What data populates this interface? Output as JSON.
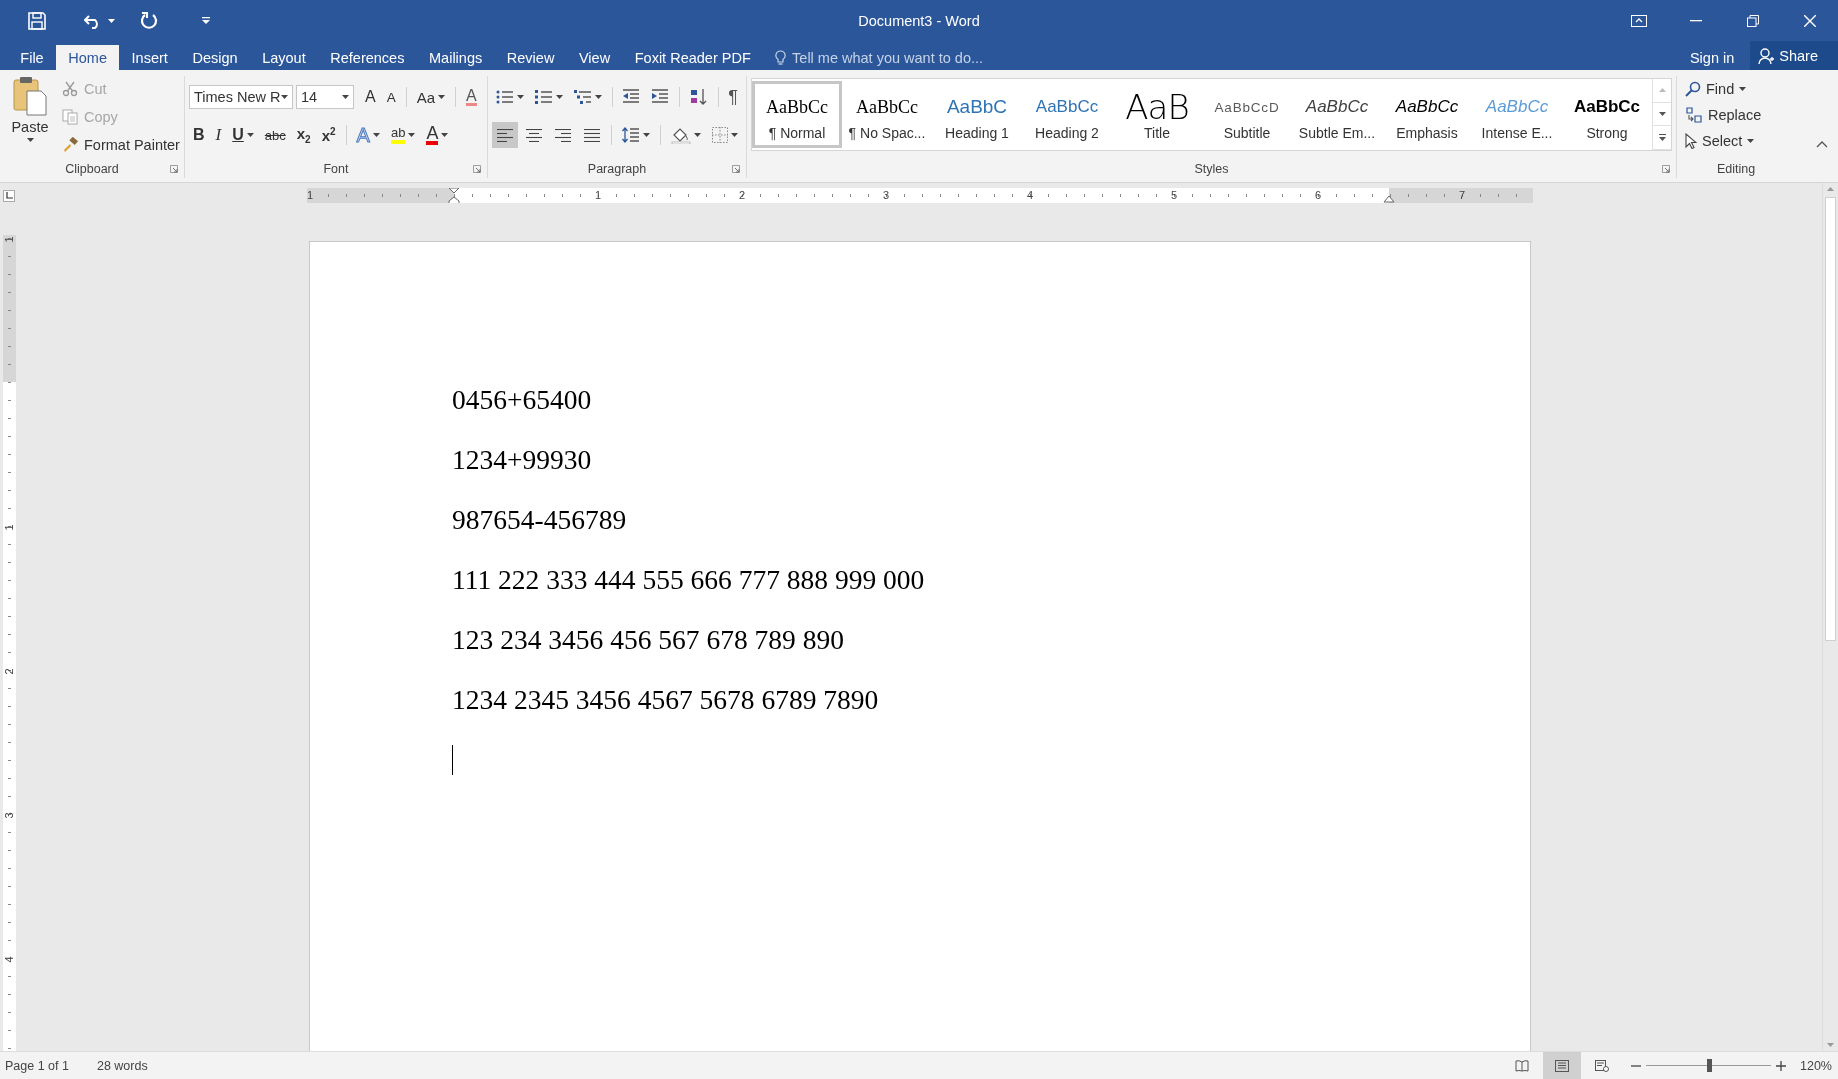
{
  "window": {
    "title": "Document3 - Word"
  },
  "tabs": [
    {
      "label": "File",
      "selected": false
    },
    {
      "label": "Home",
      "selected": true
    },
    {
      "label": "Insert",
      "selected": false
    },
    {
      "label": "Design",
      "selected": false
    },
    {
      "label": "Layout",
      "selected": false
    },
    {
      "label": "References",
      "selected": false
    },
    {
      "label": "Mailings",
      "selected": false
    },
    {
      "label": "Review",
      "selected": false
    },
    {
      "label": "View",
      "selected": false
    },
    {
      "label": "Foxit Reader PDF",
      "selected": false
    }
  ],
  "tell_me": {
    "placeholder": "Tell me what you want to do..."
  },
  "account": {
    "sign_in": "Sign in",
    "share": "Share"
  },
  "clipboard": {
    "label": "Clipboard",
    "paste": "Paste",
    "commands": [
      {
        "label": "Cut",
        "kind": "cut",
        "disabled": true
      },
      {
        "label": "Copy",
        "kind": "copy",
        "disabled": true
      },
      {
        "label": "Format Painter",
        "kind": "painter",
        "disabled": false
      }
    ]
  },
  "font": {
    "label": "Font",
    "name": "Times New R",
    "size": "14",
    "tools": [
      {
        "kind": "grow",
        "label": "A"
      },
      {
        "kind": "shrink",
        "label": "A"
      },
      {
        "kind": "case",
        "label": "Aa"
      },
      {
        "kind": "clear",
        "label": "A"
      }
    ],
    "formats": [
      {
        "kind": "bold",
        "label": "B"
      },
      {
        "kind": "italic",
        "label": "I"
      },
      {
        "kind": "underline",
        "label": "U"
      },
      {
        "kind": "strike",
        "label": "abc"
      },
      {
        "kind": "subscript",
        "label": "x$_{2}$"
      },
      {
        "kind": "superscript",
        "label": "x$^{2}$"
      }
    ],
    "effects": [
      {
        "kind": "effects",
        "label": "A"
      },
      {
        "kind": "highlight",
        "label": "ab"
      },
      {
        "kind": "color",
        "label": "A"
      }
    ]
  },
  "paragraph": {
    "label": "Paragraph",
    "mark": "¶",
    "alignment": [
      {
        "kind": "left",
        "selected": true
      },
      {
        "kind": "center",
        "selected": false
      },
      {
        "kind": "right",
        "selected": false
      },
      {
        "kind": "justify",
        "selected": false
      }
    ]
  },
  "styles": {
    "label": "Styles",
    "items": [
      {
        "kind": "normal",
        "preview": "AaBbCc",
        "label": "¶ Normal",
        "selected": true
      },
      {
        "kind": "nospacing",
        "preview": "AaBbCc",
        "label": "¶ No Spac...",
        "selected": false
      },
      {
        "kind": "heading1",
        "preview": "AaBbC",
        "label": "Heading 1",
        "selected": false
      },
      {
        "kind": "heading2",
        "preview": "AaBbCc",
        "label": "Heading 2",
        "selected": false
      },
      {
        "kind": "title",
        "preview": "AaB",
        "label": "Title",
        "selected": false
      },
      {
        "kind": "subtitle",
        "preview": "AaBbCcD",
        "label": "Subtitle",
        "selected": false
      },
      {
        "kind": "subtle",
        "preview": "AaBbCc",
        "label": "Subtle Em...",
        "selected": false
      },
      {
        "kind": "emphasis",
        "preview": "AaBbCc",
        "label": "Emphasis",
        "selected": false
      },
      {
        "kind": "intense",
        "preview": "AaBbCc",
        "label": "Intense E...",
        "selected": false
      },
      {
        "kind": "strong",
        "preview": "AaBbCc",
        "label": "Strong",
        "selected": false
      }
    ]
  },
  "editing": {
    "label": "Editing",
    "commands": [
      {
        "kind": "find",
        "label": "Find"
      },
      {
        "kind": "replace",
        "label": "Replace"
      },
      {
        "kind": "select",
        "label": "Select"
      }
    ]
  },
  "ruler": {
    "horizontal": [
      "1",
      "1",
      "2",
      "3",
      "4",
      "5",
      "6",
      "7"
    ],
    "vertical": [
      "1",
      "1",
      "2",
      "3",
      "4"
    ]
  },
  "document": {
    "paragraphs": [
      "0456+65400",
      "1234+99930",
      "987654-456789",
      "111 222 333 444 555 666 777 888 999 000",
      "123 234 3456 456 567 678 789 890",
      "1234 2345 3456 4567 5678 6789 7890"
    ]
  },
  "status_bar": {
    "page": "Page 1 of 1",
    "words": "28 words",
    "views": [
      {
        "kind": "read",
        "selected": false
      },
      {
        "kind": "print",
        "selected": true
      },
      {
        "kind": "web",
        "selected": false
      }
    ],
    "zoom": {
      "level": 0.5,
      "reading": "120%"
    }
  }
}
